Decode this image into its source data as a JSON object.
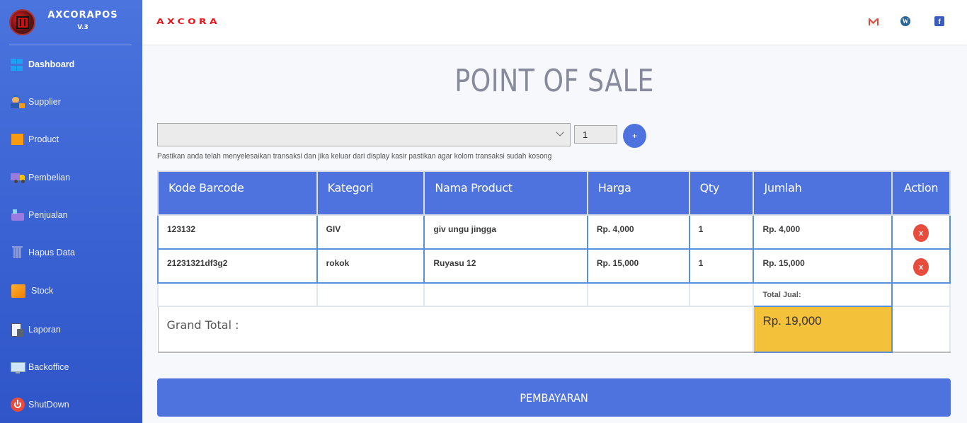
{
  "sidebar": {
    "brand_name": "AXCORAPOS",
    "brand_version": "V.3",
    "items": [
      {
        "label": "Dashboard",
        "icon": "windows-icon",
        "active": true
      },
      {
        "label": "Supplier",
        "icon": "supplier-icon"
      },
      {
        "label": "Product",
        "icon": "box-icon"
      },
      {
        "label": "Pembelian",
        "icon": "truck-icon"
      },
      {
        "label": "Penjualan",
        "icon": "cash-register-icon"
      },
      {
        "label": "Hapus Data",
        "icon": "trash-icon"
      },
      {
        "label": "Stock",
        "icon": "package-icon"
      },
      {
        "label": "Laporan",
        "icon": "report-calculator-icon"
      },
      {
        "label": "Backoffice",
        "icon": "monitor-icon"
      },
      {
        "label": "ShutDown",
        "icon": "power-icon"
      }
    ]
  },
  "topbar": {
    "logo_text": "AXCORA",
    "social": [
      {
        "name": "gmail",
        "glyph": ""
      },
      {
        "name": "wordpress",
        "glyph": "W"
      },
      {
        "name": "facebook",
        "glyph": "f"
      }
    ]
  },
  "main": {
    "title": "POINT OF SALE",
    "product_select": {
      "value": ""
    },
    "qty_input": {
      "value": "1"
    },
    "add_button_label": "+",
    "hint": "Pastikan anda telah menyelesaikan transaksi dan jika keluar dari display kasir pastikan agar kolom transaksi sudah kosong",
    "table": {
      "columns": [
        "Kode Barcode",
        "Kategori",
        "Nama Product",
        "Harga",
        "Qty",
        "Jumlah",
        "Action"
      ],
      "rows": [
        {
          "barcode": "123132",
          "kategori": "GIV",
          "nama": "giv ungu jingga",
          "harga": "Rp. 4,000",
          "qty": "1",
          "jumlah": "Rp. 4,000",
          "action": "x"
        },
        {
          "barcode": "21231321df3g2",
          "kategori": "rokok",
          "nama": "Ruyasu 12",
          "harga": "Rp. 15,000",
          "qty": "1",
          "jumlah": "Rp. 15,000",
          "action": "x"
        }
      ],
      "total_label": "Total Jual:",
      "grand_total_label": "Grand Total :",
      "grand_total_value": "Rp. 19,000"
    },
    "pay_button_label": "PEMBAYARAN"
  },
  "colors": {
    "primary": "#4e73df",
    "danger": "#e74c3c",
    "total_highlight": "#f4c13a",
    "logo_red": "#e8151a"
  }
}
